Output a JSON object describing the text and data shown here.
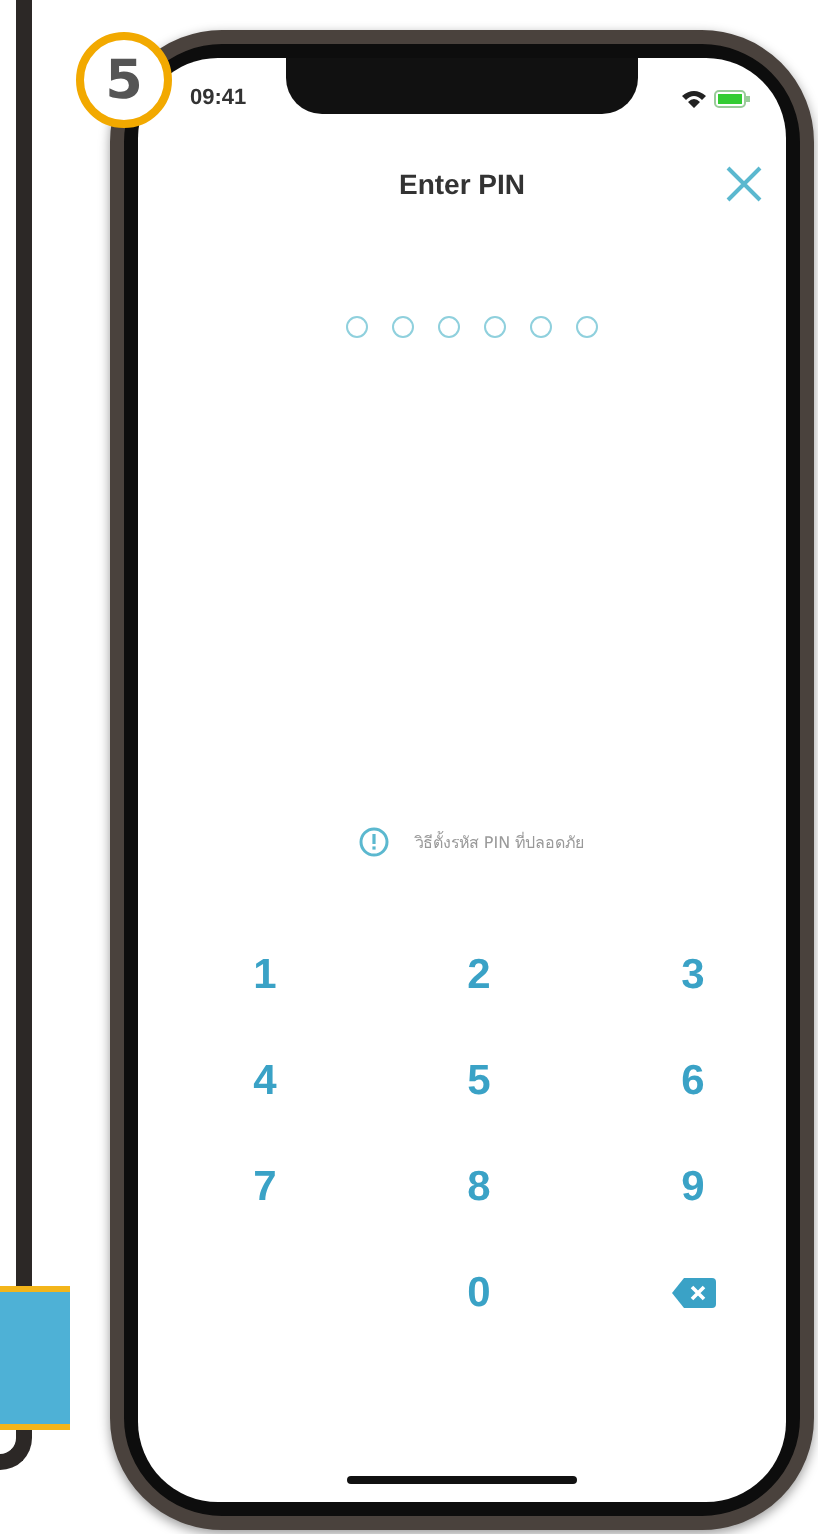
{
  "step_badge": "5",
  "status_bar": {
    "time": "09:41"
  },
  "header": {
    "title": "Enter PIN"
  },
  "pin_dots": [
    {
      "filled": false
    },
    {
      "filled": false
    },
    {
      "filled": false
    },
    {
      "filled": false
    },
    {
      "filled": false
    },
    {
      "filled": false
    }
  ],
  "hint": "วิธีตั้งรหัส PIN ที่ปลอดภัย",
  "keypad": [
    {
      "kind": "digit",
      "label": "1"
    },
    {
      "kind": "digit",
      "label": "2"
    },
    {
      "kind": "digit",
      "label": "3"
    },
    {
      "kind": "digit",
      "label": "4"
    },
    {
      "kind": "digit",
      "label": "5"
    },
    {
      "kind": "digit",
      "label": "6"
    },
    {
      "kind": "digit",
      "label": "7"
    },
    {
      "kind": "digit",
      "label": "8"
    },
    {
      "kind": "digit",
      "label": "9"
    },
    {
      "kind": "blank"
    },
    {
      "kind": "digit",
      "label": "0"
    },
    {
      "kind": "backspace"
    }
  ]
}
